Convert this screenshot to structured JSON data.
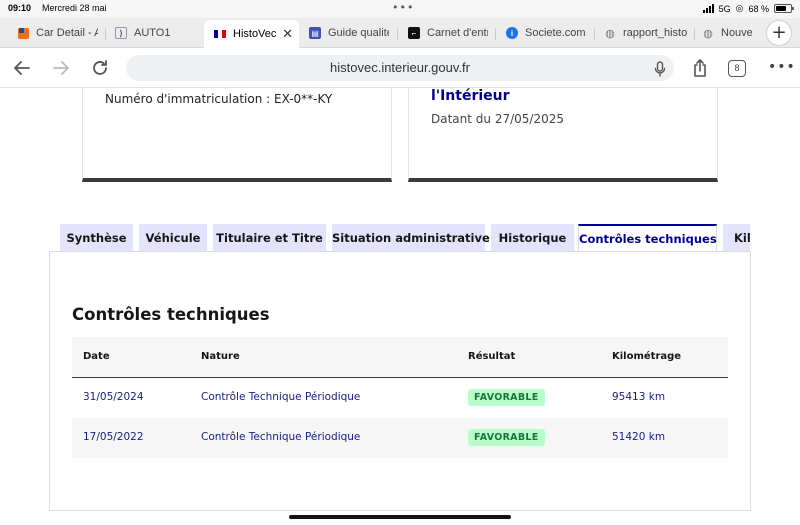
{
  "status_bar": {
    "time": "09:10",
    "date": "Mercredi 28 mai",
    "network": "5G",
    "battery": "68 %",
    "battery_level": 0.68
  },
  "browser_tabs": [
    {
      "title": "Car Detail - A",
      "icon": "car-detail-favicon",
      "color": "#e8711a"
    },
    {
      "title": "AUTO1",
      "icon": "auto1-favicon",
      "color": "#1b4f9c"
    },
    {
      "title": "HistoVec",
      "icon": "french-flag-favicon",
      "active": true
    },
    {
      "title": "Guide qualité",
      "icon": "guide-favicon",
      "color": "#3f51b5"
    },
    {
      "title": "Carnet d'entr",
      "icon": "carnet-favicon",
      "color": "#111111"
    },
    {
      "title": "Societe.com",
      "icon": "info-favicon",
      "color": "#1a73e8"
    },
    {
      "title": "rapport_histo",
      "icon": "globe-favicon",
      "color": "#777777"
    },
    {
      "title": "Nouve",
      "icon": "globe-favicon",
      "color": "#777777"
    }
  ],
  "toolbar": {
    "url": "histovec.interieur.gouv.fr",
    "tab_count": "8"
  },
  "cards": {
    "left": {
      "plate_line": "Numéro d'immatriculation : EX-0**-KY"
    },
    "right": {
      "ministry": "l'Intérieur",
      "dated": "Datant du 27/05/2025"
    }
  },
  "tabs": [
    {
      "label": "Synthèse"
    },
    {
      "label": "Véhicule"
    },
    {
      "label": "Titulaire et Titre"
    },
    {
      "label": "Situation administrative"
    },
    {
      "label": "Historique"
    },
    {
      "label": "Contrôles techniques",
      "active": true
    },
    {
      "label": "Kil"
    }
  ],
  "section": {
    "title": "Contrôles techniques",
    "columns": [
      "Date",
      "Nature",
      "Résultat",
      "Kilométrage"
    ],
    "rows": [
      {
        "date": "31/05/2024",
        "nature": "Contrôle Technique Périodique",
        "result": "FAVORABLE",
        "mileage": "95413 km"
      },
      {
        "date": "17/05/2022",
        "nature": "Contrôle Technique Périodique",
        "result": "FAVORABLE",
        "mileage": "51420 km"
      }
    ]
  },
  "colors": {
    "accent": "#000091",
    "tab_background": "#e3e3fd",
    "badge_background": "#b8fec9",
    "badge_text": "#18753c",
    "link_text": "#161e82"
  }
}
